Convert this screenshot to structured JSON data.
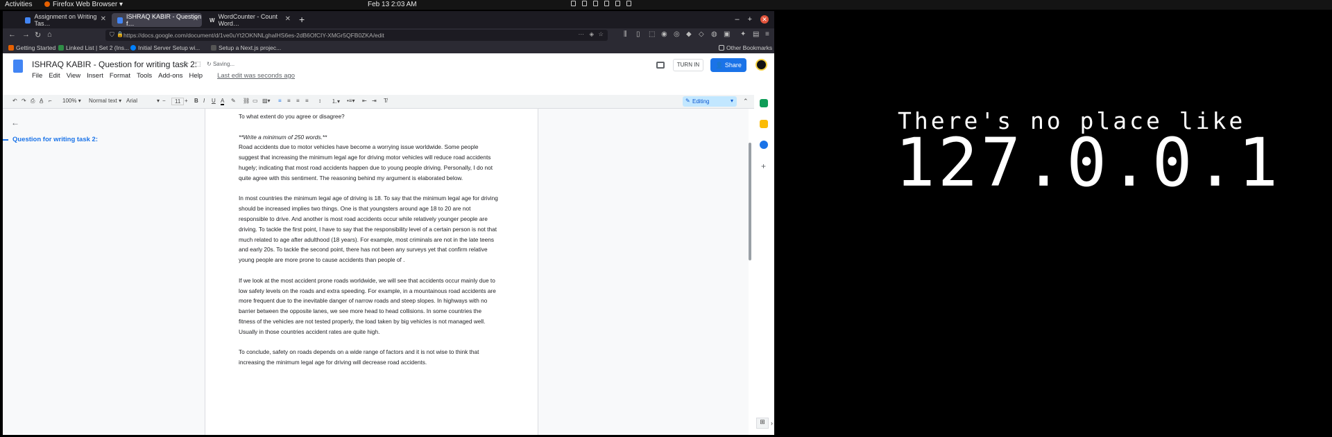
{
  "system": {
    "activities": "Activities",
    "app_menu": "Firefox Web Browser ▾",
    "datetime": "Feb 13  2:03 AM"
  },
  "tabs": [
    {
      "label": "Assignment on Writing Tas…",
      "color": "#4285f4"
    },
    {
      "label": "ISHRAQ KABIR - Question f…",
      "color": "#4285f4"
    },
    {
      "label": "WordCounter - Count Word…",
      "color": "#ffffff"
    }
  ],
  "nav": {
    "url": "https://docs.google.com/document/d/1ve0uYt2OKNNLghaIHS6es-2dB6OfCIY-XMGr5QFB0ZKA/edit"
  },
  "bookmarks": [
    {
      "label": "Getting Started"
    },
    {
      "label": "Linked List | Set 2 (Ins..."
    },
    {
      "label": "Initial Server Setup wi..."
    },
    {
      "label": "Setup a Next.js projec..."
    },
    {
      "label": "Other Bookmarks"
    }
  ],
  "doc": {
    "title": "ISHRAQ KABIR - Question for writing task 2:",
    "saving": "Saving...",
    "menus": [
      "File",
      "Edit",
      "View",
      "Insert",
      "Format",
      "Tools",
      "Add-ons",
      "Help"
    ],
    "last_edit": "Last edit was seconds ago",
    "turn_in": "TURN IN",
    "share": "Share"
  },
  "toolbar": {
    "zoom": "100%",
    "style": "Normal text",
    "font": "Arial",
    "font_size": "11",
    "mode": "Editing"
  },
  "outline": {
    "heading": "Question for writing task 2:"
  },
  "content": {
    "line1": "To what extent do you agree or disagree?",
    "line2": "**Write a minimum of 250 words.**",
    "p1": "Road accidents due to motor vehicles have become a worrying issue worldwide. Some people suggest that increasing the minimum legal age for driving motor vehicles will reduce road accidents hugely; indicating that most road accidents happen due to young people driving. Personally, I do not quite agree with this sentiment. The reasoning behind my argument is elaborated below.",
    "p2": "In most countries the minimum legal age of driving is 18. To say that the minimum legal age for driving should be increased implies two things. One is that youngsters around age 18 to 20 are not responsible to drive. And another is most road accidents occur while relatively younger people are driving. To tackle the first point, I have to say that the responsibility level of a certain person is not that much related to age after adulthood (18 years). For example, most criminals are not in the late teens and early 20s. To tackle the second point, there has not been any surveys yet that confirm relative young people are more prone to cause accidents than people of .",
    "p3": "If we look at the most accident prone roads worldwide, we will see that accidents occur mainly due to low safety levels on the roads and extra speeding. For example, in a mountainous road accidents are more frequent due to the inevitable danger of narrow roads and steep slopes. In highways with no  barrier between the opposite lanes, we see more head to head collisions. In some countries the fitness of the vehicles are not tested properly, the load taken by big vehicles is not managed well. Usually in those countries accident rates are quite high.",
    "p4": "To conclude, safety on roads depends on a wide range of factors and it is not wise to think that increasing the minimum legal age for driving will decrease road accidents."
  },
  "desktop": {
    "line1": "There's no place like",
    "line2": "127.0.0.1"
  }
}
